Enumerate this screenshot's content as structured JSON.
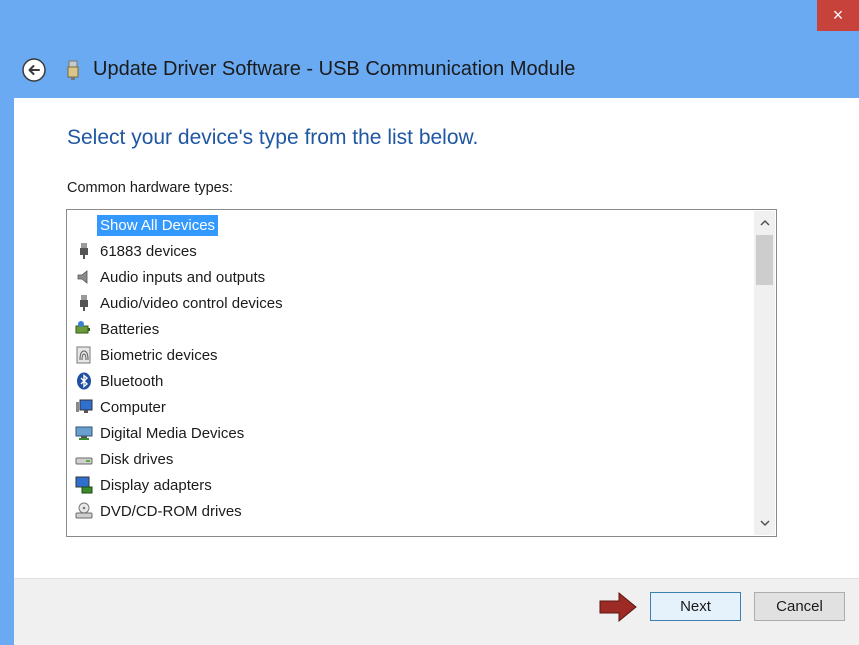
{
  "window": {
    "title": "Update Driver Software - USB Communication Module",
    "close_glyph": "×"
  },
  "main": {
    "heading": "Select your device's type from the list below.",
    "list_label": "Common hardware types:"
  },
  "hardware_list": {
    "items": [
      {
        "label": "Show All Devices",
        "icon": "none",
        "selected": true
      },
      {
        "label": "61883 devices",
        "icon": "usb-plug-icon"
      },
      {
        "label": "Audio inputs and outputs",
        "icon": "speaker-icon"
      },
      {
        "label": "Audio/video control devices",
        "icon": "usb-plug-icon"
      },
      {
        "label": "Batteries",
        "icon": "battery-icon"
      },
      {
        "label": "Biometric devices",
        "icon": "fingerprint-icon"
      },
      {
        "label": "Bluetooth",
        "icon": "bluetooth-icon"
      },
      {
        "label": "Computer",
        "icon": "computer-icon"
      },
      {
        "label": "Digital Media Devices",
        "icon": "media-device-icon"
      },
      {
        "label": "Disk drives",
        "icon": "disk-drive-icon"
      },
      {
        "label": "Display adapters",
        "icon": "display-adapter-icon"
      },
      {
        "label": "DVD/CD-ROM drives",
        "icon": "dvd-drive-icon"
      }
    ]
  },
  "footer": {
    "next_label": "Next",
    "cancel_label": "Cancel"
  },
  "colors": {
    "titlebar": "#6aaaf2",
    "close": "#c7423a",
    "heading": "#1f57a3",
    "selection": "#3399ff",
    "arrow": "#9b2b24"
  }
}
